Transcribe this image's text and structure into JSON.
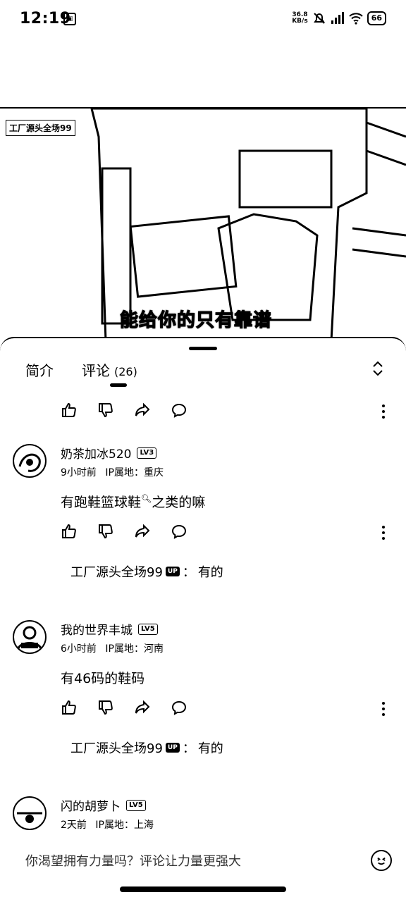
{
  "status_bar": {
    "time": "12:19",
    "net_speed_value": "36.8",
    "net_speed_unit": "KB/s",
    "battery": "66"
  },
  "video": {
    "watermark": "工厂源头全场99",
    "subtitle": "能给你的只有靠谱"
  },
  "tabs": {
    "intro": "简介",
    "comments": "评论",
    "comments_count": "(26)"
  },
  "comments": [
    {
      "user": "奶茶加冰520",
      "level": "LV3",
      "time": "9小时前",
      "ip": "IP属地：重庆",
      "text": "有跑鞋篮球鞋",
      "text_tail": "之类的嘛",
      "reply": {
        "author": "工厂源头全场99",
        "badge": "UP",
        "sep": "：",
        "text": "有的"
      }
    },
    {
      "user": "我的世界丰城",
      "level": "LV5",
      "time": "6小时前",
      "ip": "IP属地：河南",
      "text": "有46码的鞋码",
      "reply": {
        "author": "工厂源头全场99",
        "badge": "UP",
        "sep": "：",
        "text": "有的"
      }
    },
    {
      "user": "闪的胡萝卜",
      "level": "LV5",
      "time": "2天前",
      "ip": "IP属地：上海"
    }
  ],
  "input": {
    "placeholder": "你渴望拥有力量吗？评论让力量更强大"
  }
}
